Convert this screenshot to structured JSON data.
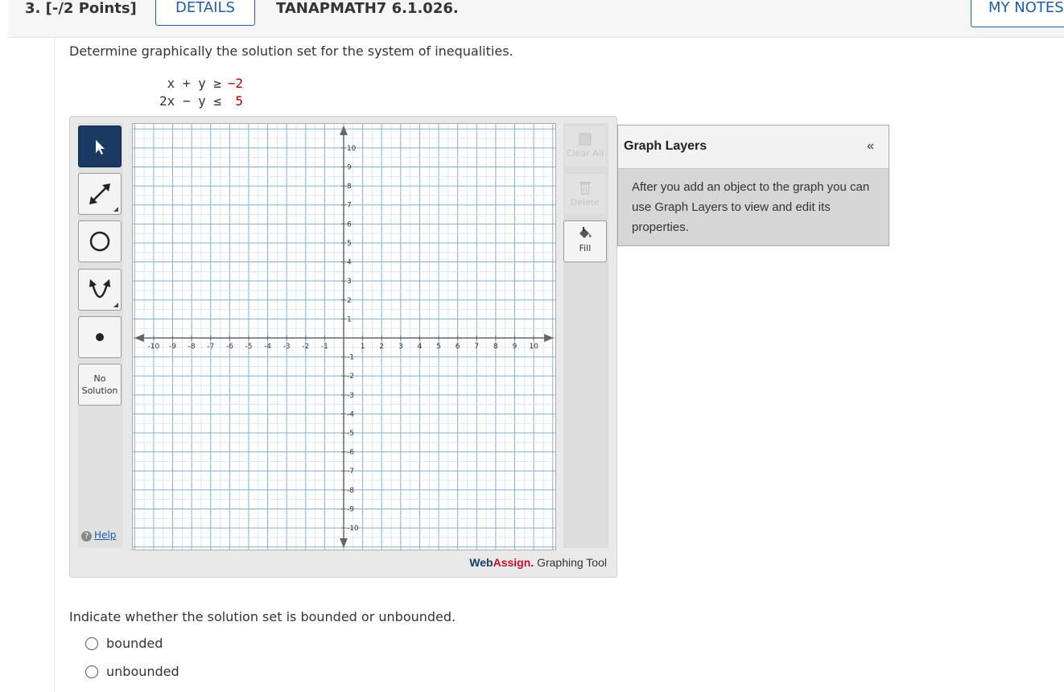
{
  "header": {
    "question_number": "3. [-/2 Points]",
    "details_label": "DETAILS",
    "question_code": "TANAPMATH7 6.1.026.",
    "my_notes_label": "MY NOTES"
  },
  "question": {
    "prompt": "Determine graphically the solution set for the system of inequalities.",
    "inequalities": [
      {
        "lhs": "x + y ≥",
        "rhs": "−2"
      },
      {
        "lhs": "2x − y ≤",
        "rhs": "5"
      }
    ]
  },
  "graph_tool": {
    "tools": [
      {
        "name": "pointer-tool",
        "icon": "arrow-pointer-icon"
      },
      {
        "name": "line-tool",
        "icon": "double-arrow-line-icon"
      },
      {
        "name": "circle-tool",
        "icon": "circle-icon"
      },
      {
        "name": "parabola-tool",
        "icon": "parabola-icon"
      },
      {
        "name": "point-tool",
        "icon": "point-icon"
      }
    ],
    "no_solution_label": "No Solution",
    "help_label": "Help",
    "clear_all_label": "Clear All",
    "delete_label": "Delete",
    "fill_label": "Fill",
    "brand_web": "Web",
    "brand_assign": "Assign.",
    "brand_suffix": "Graphing Tool",
    "axes": {
      "xmin": -10,
      "xmax": 10,
      "ymin": -10,
      "ymax": 10,
      "minor_step": 0.5,
      "major_step": 1
    }
  },
  "layers_panel": {
    "title": "Graph Layers",
    "collapse_icon": "«",
    "body": "After you add an object to the graph you can use Graph Layers to view and edit its properties."
  },
  "question2": {
    "prompt": "Indicate whether the solution set is bounded or unbounded.",
    "options": [
      "bounded",
      "unbounded"
    ]
  },
  "colors": {
    "accent": "#1d5ea8",
    "rhs_red": "#b20000",
    "active_tool": "#1b3a63",
    "grid_minor": "#c8dff0",
    "grid_major": "#7fb0d6"
  }
}
